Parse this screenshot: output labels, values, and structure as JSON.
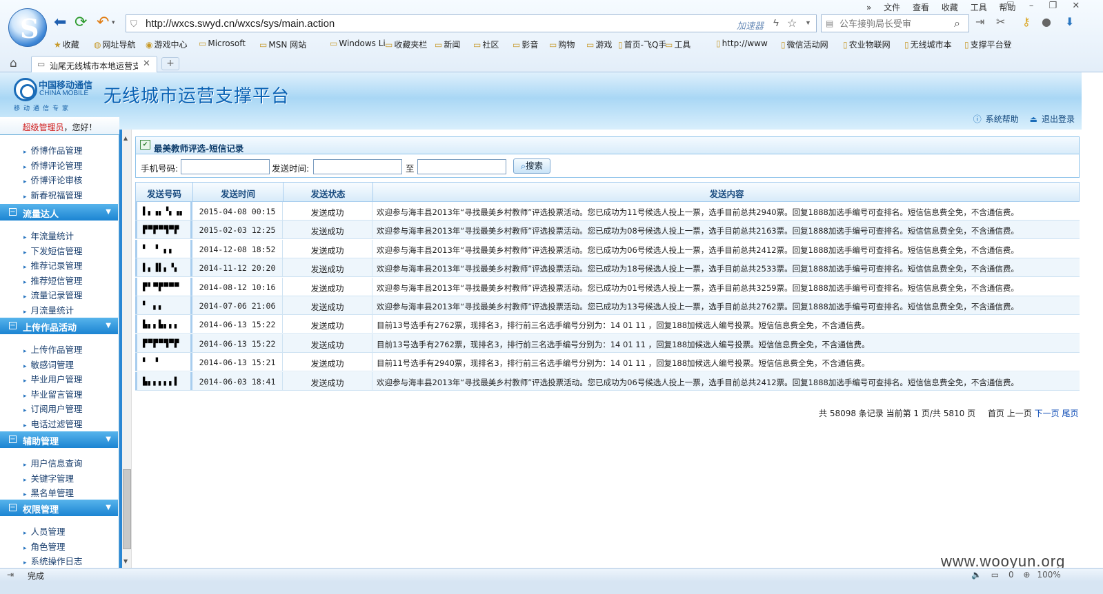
{
  "browser": {
    "url": "http://wxcs.swyd.cn/wxcs/sys/main.action",
    "accelerator_label": "加速器",
    "search_placeholder": "公车接驹局长受审",
    "menus": [
      "文件",
      "查看",
      "收藏",
      "工具",
      "帮助"
    ],
    "favorites": [
      {
        "label": "收藏",
        "icon": "star-icon"
      },
      {
        "label": "网址导航",
        "icon": "globe-icon"
      },
      {
        "label": "游戏中心",
        "icon": "game-icon"
      },
      {
        "label": "Microsoft",
        "icon": "folder-icon"
      },
      {
        "label": "MSN 网站",
        "icon": "folder-icon"
      },
      {
        "label": "Windows Li",
        "icon": "folder-icon"
      },
      {
        "label": "收藏夹栏",
        "icon": "folder-icon"
      },
      {
        "label": "新闻",
        "icon": "folder-icon"
      },
      {
        "label": "社区",
        "icon": "folder-icon"
      },
      {
        "label": "影音",
        "icon": "folder-icon"
      },
      {
        "label": "购物",
        "icon": "folder-icon"
      },
      {
        "label": "游戏",
        "icon": "folder-icon"
      },
      {
        "label": "首页-飞Q手",
        "icon": "page-icon"
      },
      {
        "label": "工具",
        "icon": "folder-icon"
      },
      {
        "label": "http://www",
        "icon": "page-icon"
      },
      {
        "label": "微信活动网",
        "icon": "page-icon"
      },
      {
        "label": "农业物联网",
        "icon": "page-icon"
      },
      {
        "label": "无线城市本",
        "icon": "page-icon"
      },
      {
        "label": "支撑平台登",
        "icon": "page-icon"
      }
    ],
    "tab_title": "汕尾无线城市本地运营支",
    "status_text": "完成",
    "zoom": "100%",
    "download_count": "0"
  },
  "header": {
    "logo_cn": "中国移动通信",
    "logo_en": "CHINA MOBILE",
    "logo_sub": "移动通信专家",
    "title": "无线城市运营支撑平台",
    "help_label": "系统帮助",
    "logout_label": "退出登录"
  },
  "sidebar": {
    "greeting_role": "超级管理员",
    "greeting_suffix": "，您好！",
    "top_items": [
      "侨博作品管理",
      "侨博评论管理",
      "侨博评论审核",
      "新春祝福管理"
    ],
    "groups": [
      {
        "label": "流量达人",
        "items": [
          "年流量统计",
          "下发短信管理",
          "推荐记录管理",
          "推荐短信管理",
          "流量记录管理",
          "月流量统计"
        ]
      },
      {
        "label": "上传作品活动",
        "items": [
          "上传作品管理",
          "敏感词管理",
          "毕业用户管理",
          "毕业留言管理",
          "订阅用户管理",
          "电话过滤管理"
        ]
      },
      {
        "label": "辅助管理",
        "items": [
          "用户信息查询",
          "关键字管理",
          "黑名单管理"
        ]
      },
      {
        "label": "权限管理",
        "items": [
          "人员管理",
          "角色管理",
          "系统操作日志"
        ]
      }
    ]
  },
  "panel": {
    "title": "最美教师评选-短信记录",
    "phone_label": "手机号码:",
    "time_label": "发送时间:",
    "to_label": "至",
    "search_button": "搜索",
    "phone_value": "",
    "time_from": "",
    "time_to": ""
  },
  "table": {
    "headers": [
      "发送号码",
      "发送时间",
      "发送状态",
      "发送内容"
    ],
    "rows": [
      {
        "phone": "▌▖▗▖▝▖▗▖",
        "time": "2015-04-08 00:15",
        "status": "发送成功",
        "content": "欢迎参与海丰县2013年“寻找最美乡村教师”评选投票活动。您已成功为11号候选人投上一票，选手目前总共2940票。回复1888加选手编号可查排名。短信信息费全免，不含通信费。"
      },
      {
        "phone": "▛▀▛▀▜▀▛",
        "time": "2015-02-03 12:25",
        "status": "发送成功",
        "content": "欢迎参与海丰县2013年“寻找最美乡村教师”评选投票活动。您已成功为08号候选人投上一票，选手目前总共2163票。回复1888加选手编号可查排名。短信信息费全免，不含通信费。"
      },
      {
        "phone": "▘ ▝  ▖▖",
        "time": "2014-12-08 18:52",
        "status": "发送成功",
        "content": "欢迎参与海丰县2013年“寻找最美乡村教师”评选投票活动。您已成功为06号候选人投上一票，选手目前总共2412票。回复1888加选手编号可查排名。短信信息费全免，不含通信费。"
      },
      {
        "phone": "▌▖▐▌▖▝▖",
        "time": "2014-11-12 20:20",
        "status": "发送成功",
        "content": "欢迎参与海丰县2013年“寻找最美乡村教师”评选投票活动。您已成功为18号候选人投上一票，选手目前总共2533票。回复1888加选手编号可查排名。短信信息费全免，不含通信费。"
      },
      {
        "phone": "▛▘▀▛▀▀▀",
        "time": "2014-08-12 10:16",
        "status": "发送成功",
        "content": "欢迎参与海丰县2013年“寻找最美乡村教师”评选投票活动。您已成功为01号候选人投上一票，选手目前总共3259票。回复1888加选手编号可查排名。短信信息费全免，不含通信费。"
      },
      {
        "phone": "▘   ▖▖",
        "time": "2014-07-06 21:06",
        "status": "发送成功",
        "content": "欢迎参与海丰县2013年“寻找最美乡村教师”评选投票活动。您已成功为13号候选人投上一票，选手目前总共2762票。回复1888加选手编号可查排名。短信信息费全免，不含通信费。"
      },
      {
        "phone": "▙▖▖▙▖▖▖",
        "time": "2014-06-13 15:22",
        "status": "发送成功",
        "content": "目前13号选手有2762票，现排名3，排行前三名选手编号分别为：14 01 11 ，回复188加候选人编号投票。短信信息费全免，不含通信费。"
      },
      {
        "phone": "▛▀▛▀▜▀▛",
        "time": "2014-06-13 15:22",
        "status": "发送成功",
        "content": "目前13号选手有2762票，现排名3，排行前三名选手编号分别为：14 01 11 ，回复188加候选人编号投票。短信信息费全免，不含通信费。"
      },
      {
        "phone": "▘   ▝",
        "time": "2014-06-13 15:21",
        "status": "发送成功",
        "content": "目前11号选手有2940票，现排名3，排行前三名选手编号分别为：14 01 11 ，回复188加候选人编号投票。短信信息费全免，不含通信费。"
      },
      {
        "phone": "▙▖▖▖▖▖▌",
        "time": "2014-06-03 18:41",
        "status": "发送成功",
        "content": "欢迎参与海丰县2013年“寻找最美乡村教师”评选投票活动。您已成功为06号候选人投上一票，选手目前总共2412票。回复1888加选手编号可查排名。短信信息费全免，不含通信费。"
      }
    ]
  },
  "pager": {
    "summary": "共 58098 条记录 当前第 1 页/共 5810 页",
    "first": "首页",
    "prev": "上一页",
    "next": "下一页",
    "last": "尾页"
  },
  "watermark": "www.wooyun.org"
}
